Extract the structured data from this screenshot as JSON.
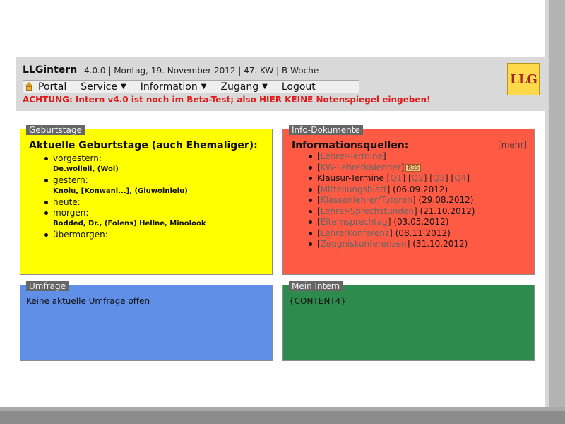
{
  "header": {
    "brand": "LLGintern",
    "meta": "4.0.0 | Montag, 19. November 2012 | 47. KW | B-Woche",
    "logo_text": "LLG",
    "warning": "ACHTUNG: Intern v4.0 ist noch im Beta-Test; also HIER KEINE Notenspiegel eingeben!"
  },
  "nav": {
    "items": [
      {
        "label": "Portal",
        "icon": "home-icon"
      },
      {
        "label": "Service",
        "caret": "▼"
      },
      {
        "label": "Information",
        "caret": "▼"
      },
      {
        "label": "Zugang",
        "caret": "▼"
      },
      {
        "label": "Logout"
      }
    ]
  },
  "birthdays": {
    "tab": "Geburtstage",
    "title": "Aktuelle Geburtstage (auch Ehemaliger):",
    "items": [
      {
        "label": "vorgestern:",
        "names": "De.wolleli, (Wol)"
      },
      {
        "label": "gestern:",
        "names": "Knolu, [Konwanl...], (Gluwolnlelu)"
      },
      {
        "label": "heute:",
        "names": ""
      },
      {
        "label": "morgen:",
        "names": "Bodded, Dr., (Folens) Hellne, Minolook"
      },
      {
        "label": "übermorgen:",
        "names": ""
      }
    ]
  },
  "info": {
    "tab": "Info-Dokumente",
    "title": "Informationsquellen:",
    "more": "[mehr]",
    "items": [
      {
        "link": "Lehrer-Termine",
        "date": ""
      },
      {
        "link": "KW-Lehrerkalender",
        "date": "",
        "badge": "RSS"
      },
      {
        "text": "Klausur-Termine",
        "quarters": [
          "Q1",
          "Q2",
          "Q3",
          "Q4"
        ]
      },
      {
        "link": "Mitteilungsblatt",
        "date": "(06.09.2012)"
      },
      {
        "link": "Klassenlehrer/Tutoren",
        "date": "(29.08.2012)"
      },
      {
        "link": "Lehrer-Sprechstunden",
        "date": "(21.10.2012)"
      },
      {
        "link": "Elternsprechtag",
        "date": "(03.05.2012)"
      },
      {
        "link": "Lehrerkonferenz",
        "date": "(08.11.2012)"
      },
      {
        "link": "Zeugniskonferenzen",
        "date": "(31.10.2012)"
      }
    ]
  },
  "survey": {
    "tab": "Umfrage",
    "text": "Keine aktuelle Umfrage offen"
  },
  "mein": {
    "tab": "Mein Intern",
    "text": "{CONTENT4}"
  },
  "colors": {
    "birthdays_bg": "#ffff00",
    "info_bg": "#ff5a44",
    "survey_bg": "#5f8fe6",
    "mein_bg": "#2e8b4e",
    "warning": "#e01b1b"
  }
}
